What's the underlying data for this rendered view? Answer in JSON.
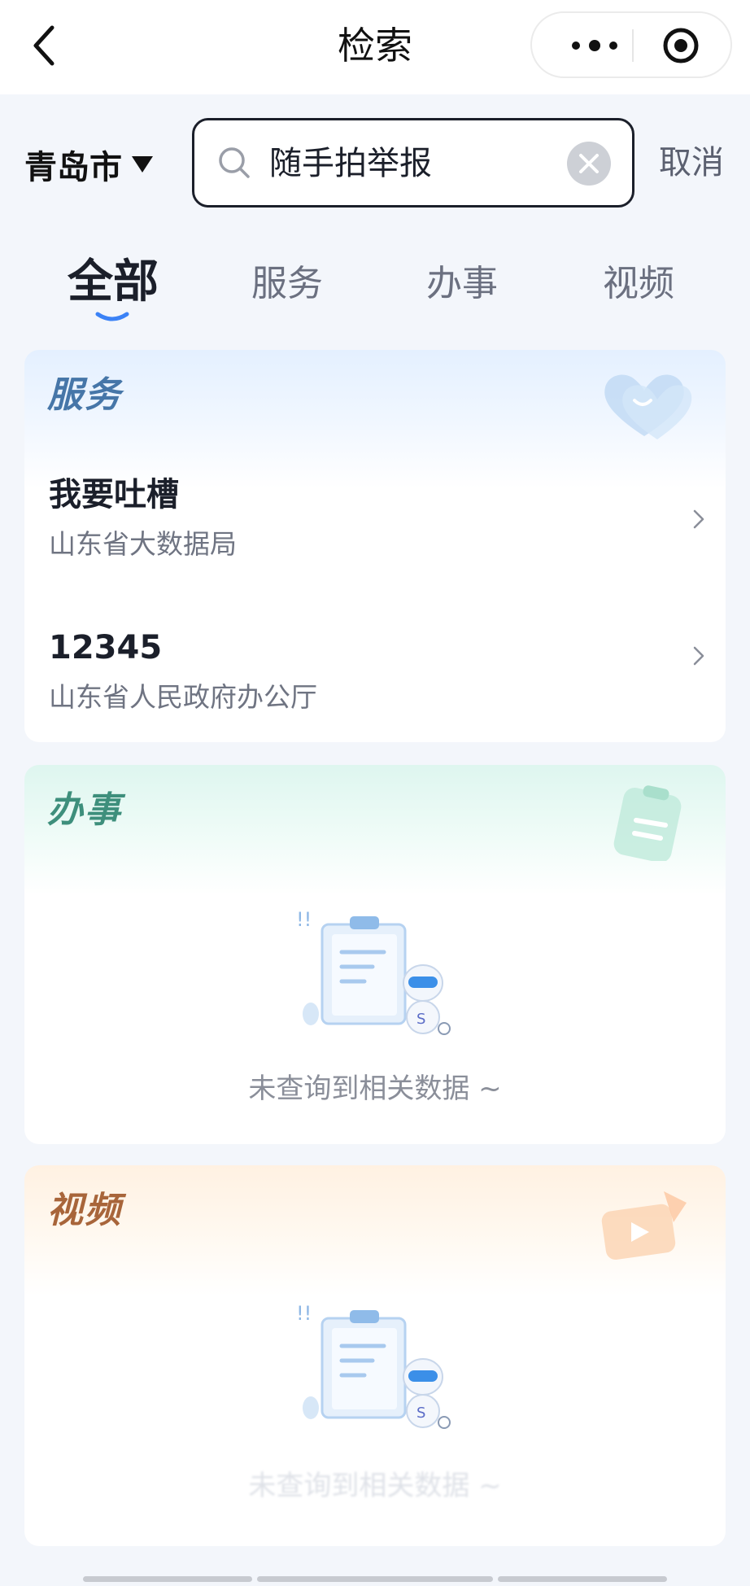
{
  "nav": {
    "title": "检索",
    "back_icon": "chevron-left-icon",
    "more_icon": "more-dots-icon",
    "close_icon": "target-circle-icon"
  },
  "search": {
    "city": "青岛市",
    "query": "随手拍举报",
    "cancel_label": "取消",
    "search_icon": "search-icon",
    "clear_icon": "clear-circle-icon"
  },
  "tabs": [
    {
      "label": "全部",
      "active": true
    },
    {
      "label": "服务",
      "active": false
    },
    {
      "label": "办事",
      "active": false
    },
    {
      "label": "视频",
      "active": false
    }
  ],
  "sections": {
    "service": {
      "title": "服务",
      "items": [
        {
          "title": "我要吐槽",
          "subtitle": "山东省大数据局"
        },
        {
          "title": "12345",
          "subtitle": "山东省人民政府办公厅"
        }
      ]
    },
    "affairs": {
      "title": "办事",
      "empty_text": "未查询到相关数据 ~"
    },
    "video": {
      "title": "视频",
      "empty_text": "未查询到相关数据 ~"
    }
  },
  "colors": {
    "accent": "#3b82f6",
    "service_title": "#4676a8",
    "affairs_title": "#3e8f7c",
    "video_title": "#a8653a"
  }
}
